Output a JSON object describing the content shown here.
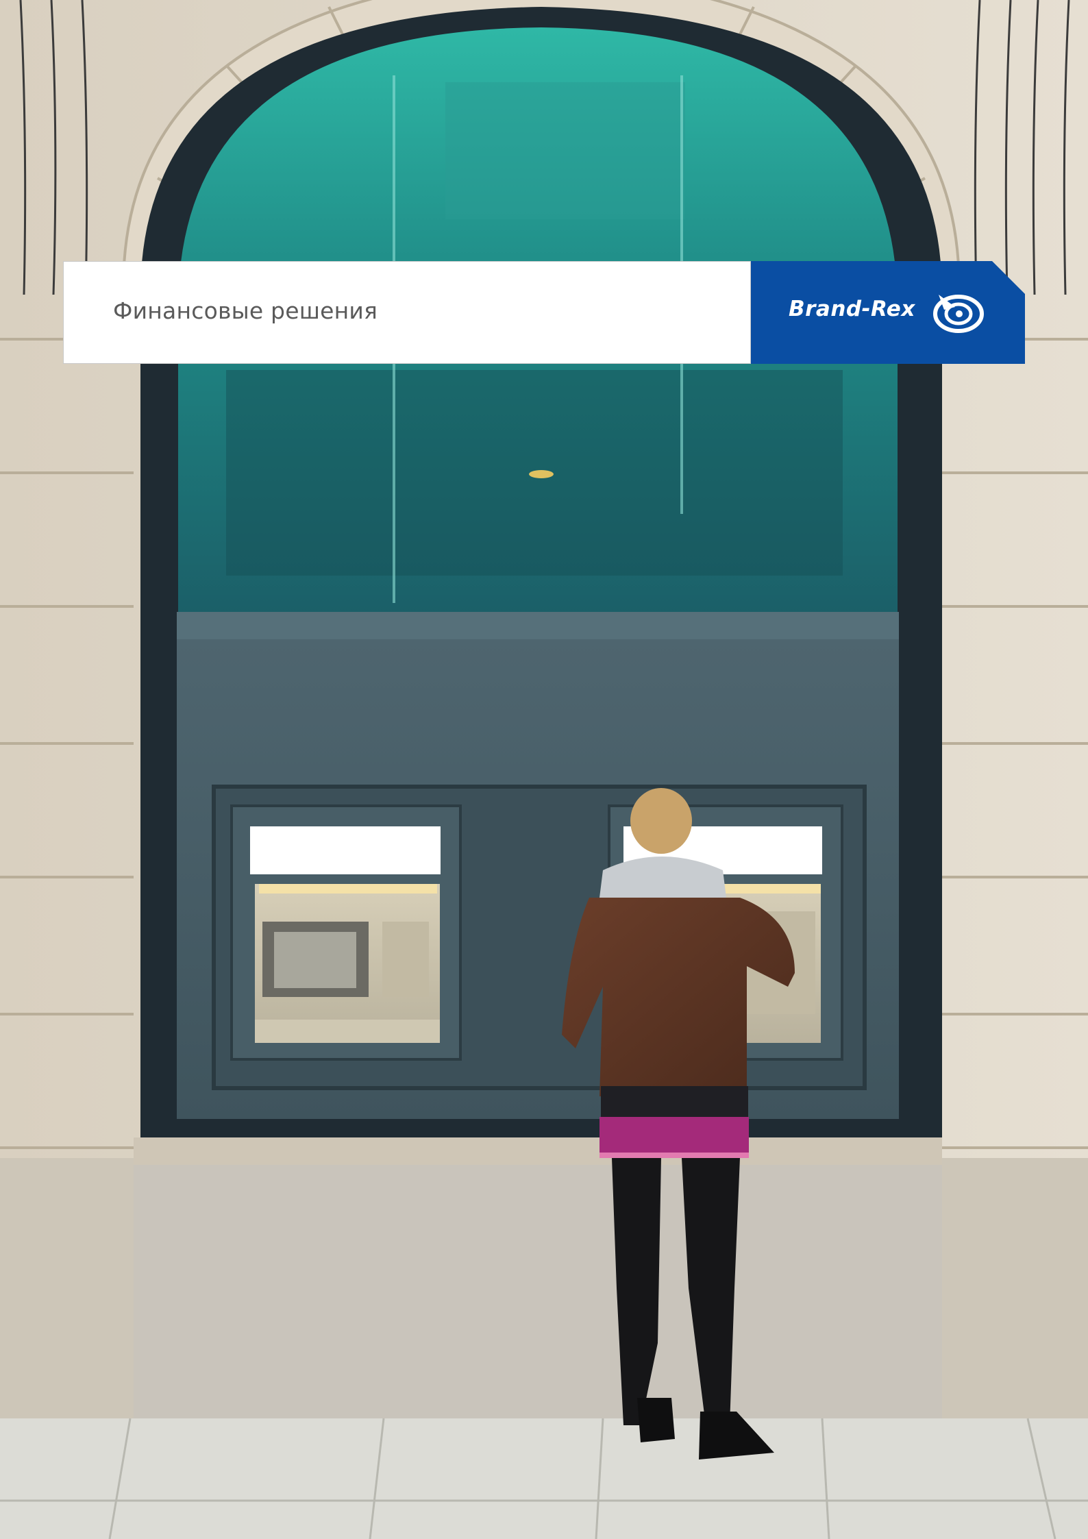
{
  "banner": {
    "title": "Финансовые решения",
    "brand": "Brand-Rex",
    "brand_color": "#0a4ea3"
  },
  "photo": {
    "icon": "atm-street-photo"
  }
}
